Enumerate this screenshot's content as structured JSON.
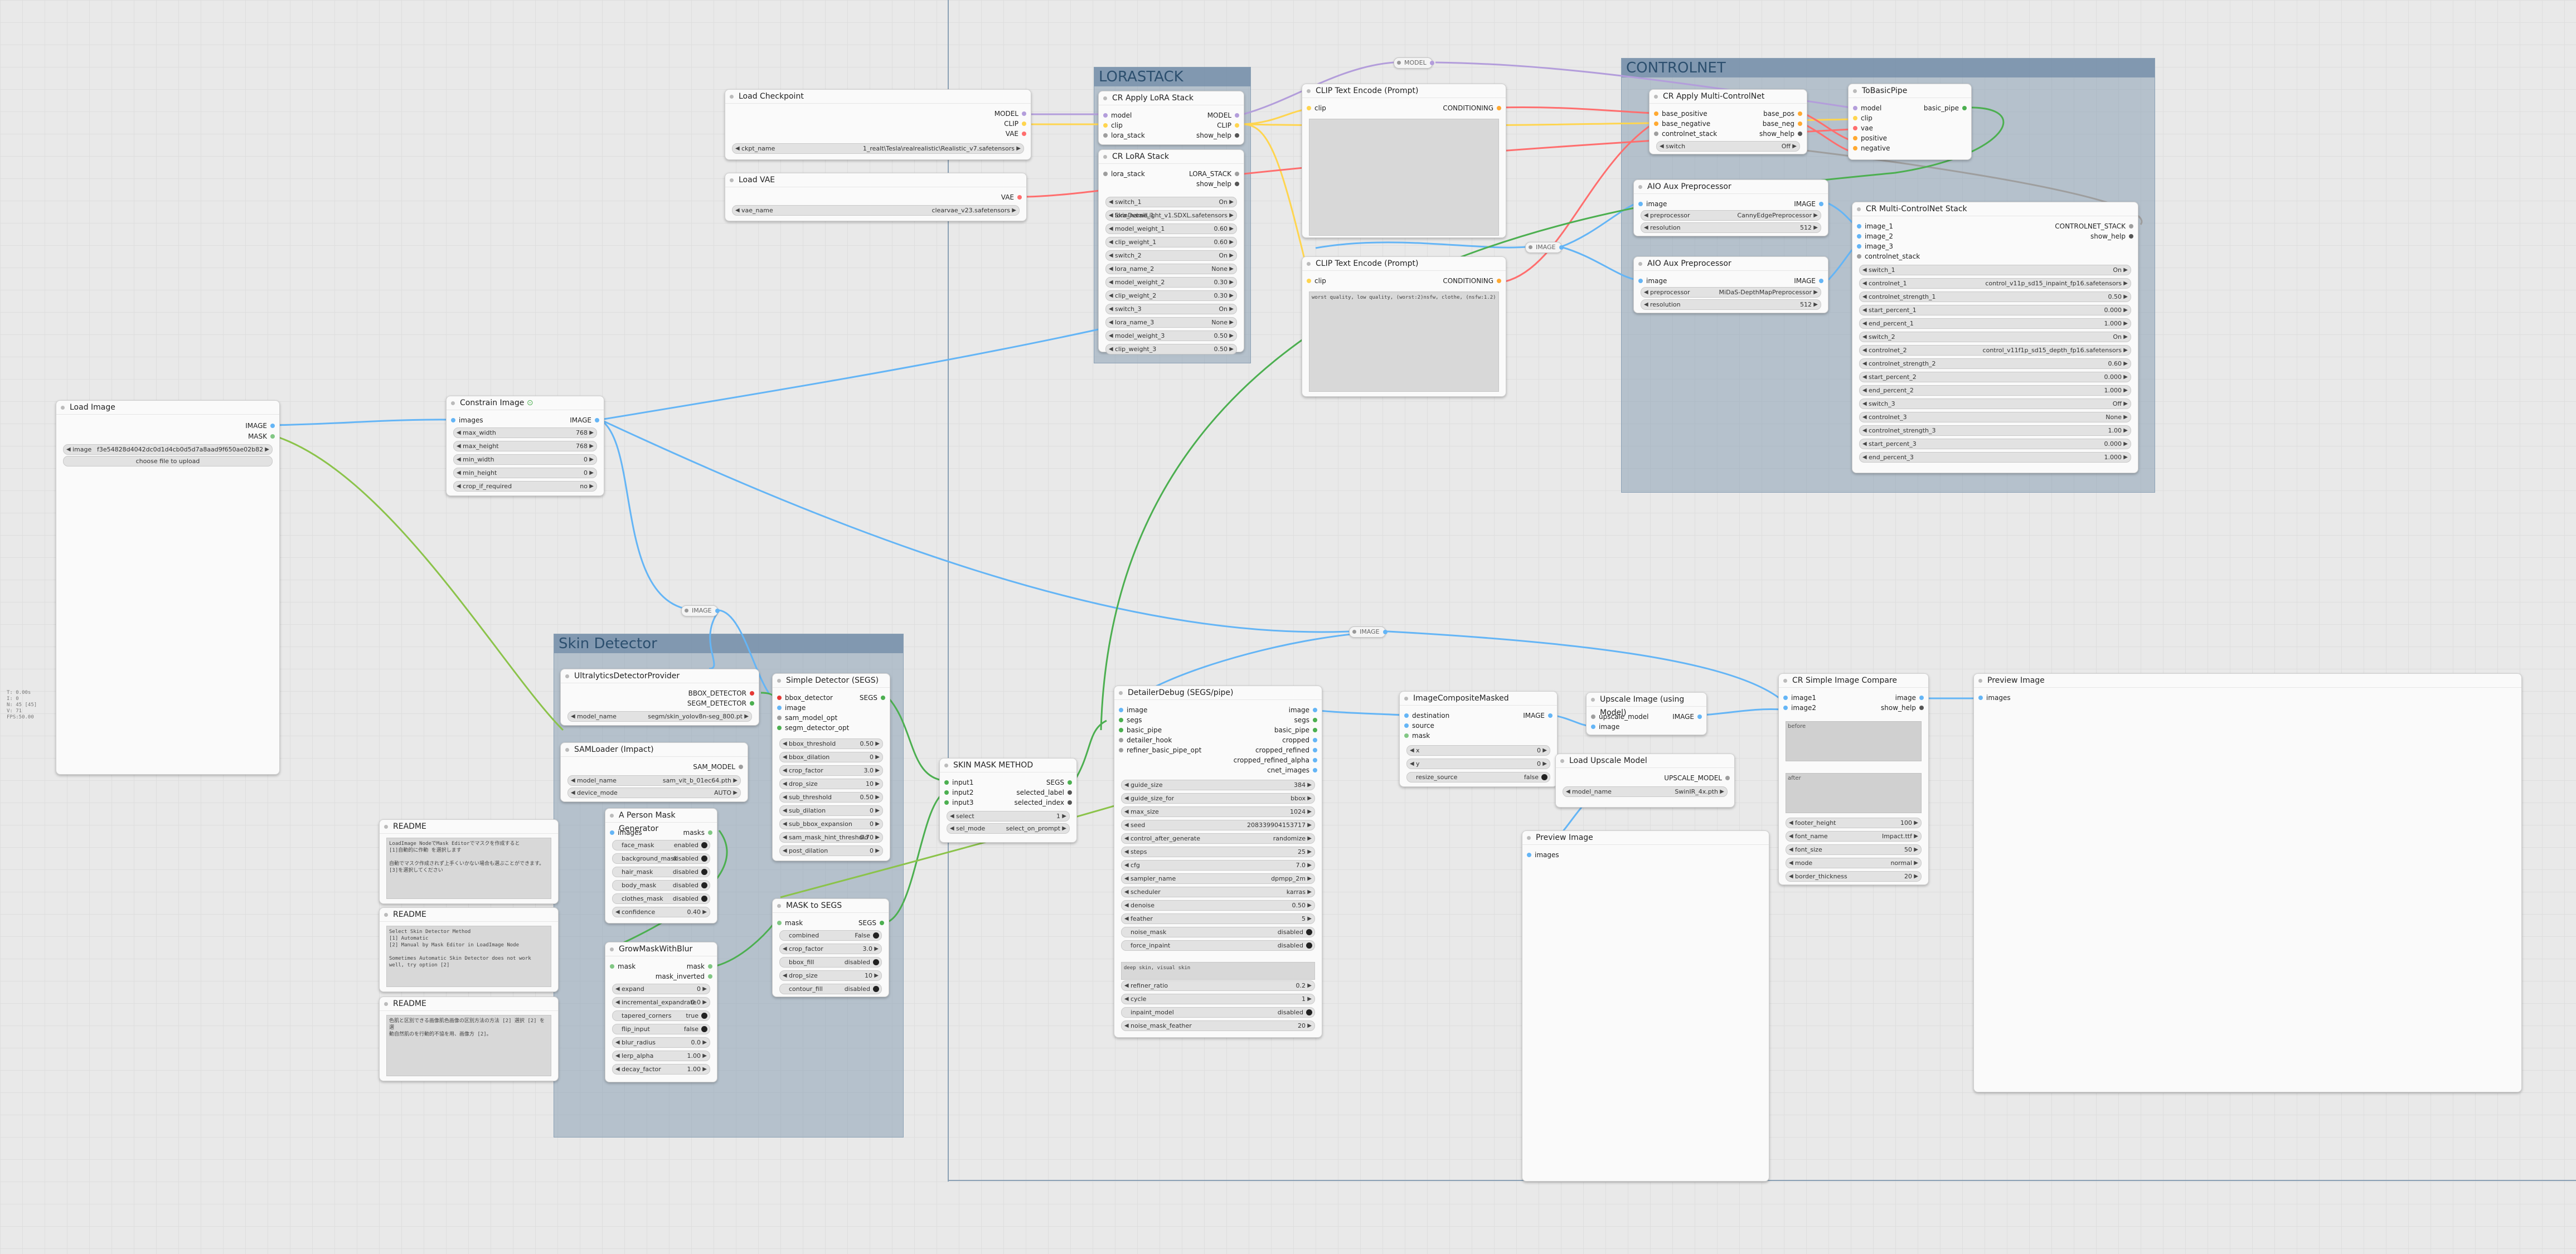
{
  "groups": {
    "lorastack": "LORASTACK",
    "controlnet": "CONTROLNET",
    "skin": "Skin Detector"
  },
  "stats": [
    "T: 0.00s",
    "I: 0",
    "N: 45 [45]",
    "V: 71",
    "FPS:50.00"
  ],
  "colors": {
    "image": "#64b5f6",
    "model": "#b39ddb",
    "clip": "#ffd54f",
    "vae": "#ff6e6e",
    "conditioning": "#ffa931",
    "mask": "#81c784",
    "lora": "#9e9e9e"
  },
  "nodes": {
    "load_checkpoint": {
      "title": "Load Checkpoint",
      "outs": [
        "MODEL",
        "CLIP",
        "VAE"
      ],
      "ckpt_label": "ckpt_name",
      "ckpt_value": "1_realt\\Tesla\\realrealistic\\Realistic_v7.safetensors"
    },
    "load_vae": {
      "title": "Load VAE",
      "out": "VAE",
      "label": "vae_name",
      "value": "clearvae_v23.safetensors"
    },
    "apply_lora": {
      "title": "CR Apply LoRA Stack",
      "ins": [
        "model",
        "clip",
        "lora_stack"
      ],
      "outs": [
        "MODEL",
        "CLIP",
        "show_help"
      ]
    },
    "lora_stack": {
      "title": "CR LoRA Stack",
      "in": "lora_stack",
      "outs": [
        "LORA_STACK",
        "show_help"
      ],
      "widgets": [
        [
          "switch_1",
          "On"
        ],
        [
          "lora_name_1",
          "SkinDetailLight_v1.SDXL.safetensors"
        ],
        [
          "model_weight_1",
          "0.60"
        ],
        [
          "clip_weight_1",
          "0.60"
        ],
        [
          "switch_2",
          "On"
        ],
        [
          "lora_name_2",
          "None"
        ],
        [
          "model_weight_2",
          "0.30"
        ],
        [
          "clip_weight_2",
          "0.30"
        ],
        [
          "switch_3",
          "On"
        ],
        [
          "lora_name_3",
          "None"
        ],
        [
          "model_weight_3",
          "0.50"
        ],
        [
          "clip_weight_3",
          "0.50"
        ]
      ]
    },
    "clip_pos": {
      "title": "CLIP Text Encode (Prompt)",
      "in": "clip",
      "out": "CONDITIONING"
    },
    "clip_neg": {
      "title": "CLIP Text Encode (Prompt)",
      "in": "clip",
      "out": "CONDITIONING",
      "text": "worst quality, low quality, (worst:2)nsfw, clothe, (nsfw:1.2)"
    },
    "apply_multi_cn": {
      "title": "CR Apply Multi-ControlNet",
      "ins": [
        "base_positive",
        "base_negative",
        "controlnet_stack"
      ],
      "outs": [
        "base_pos",
        "base_neg",
        "show_help"
      ],
      "switch_label": "switch",
      "switch_value": "Off"
    },
    "to_basic_pipe": {
      "title": "ToBasicPipe",
      "ins": [
        "model",
        "clip",
        "vae",
        "positive",
        "negative"
      ],
      "out": "basic_pipe"
    },
    "aio1": {
      "title": "AIO Aux Preprocessor",
      "in": "image",
      "out": "IMAGE",
      "pre_label": "preprocessor",
      "pre_value": "CannyEdgePreprocessor",
      "res_label": "resolution",
      "res_value": "512"
    },
    "aio2": {
      "title": "AIO Aux Preprocessor",
      "in": "image",
      "out": "IMAGE",
      "pre_label": "preprocessor",
      "pre_value": "MiDaS-DepthMapPreprocessor",
      "res_label": "resolution",
      "res_value": "512"
    },
    "multi_cn_stack": {
      "title": "CR Multi-ControlNet Stack",
      "ins": [
        "image_1",
        "image_2",
        "image_3",
        "controlnet_stack"
      ],
      "outs": [
        "CONTROLNET_STACK",
        "show_help"
      ],
      "widgets": [
        [
          "switch_1",
          "On"
        ],
        [
          "controlnet_1",
          "control_v11p_sd15_inpaint_fp16.safetensors"
        ],
        [
          "controlnet_strength_1",
          "0.50"
        ],
        [
          "start_percent_1",
          "0.000"
        ],
        [
          "end_percent_1",
          "1.000"
        ],
        [
          "switch_2",
          "On"
        ],
        [
          "controlnet_2",
          "control_v11f1p_sd15_depth_fp16.safetensors"
        ],
        [
          "controlnet_strength_2",
          "0.60"
        ],
        [
          "start_percent_2",
          "0.000"
        ],
        [
          "end_percent_2",
          "1.000"
        ],
        [
          "switch_3",
          "Off"
        ],
        [
          "controlnet_3",
          "None"
        ],
        [
          "controlnet_strength_3",
          "1.00"
        ],
        [
          "start_percent_3",
          "0.000"
        ],
        [
          "end_percent_3",
          "1.000"
        ]
      ]
    },
    "load_image": {
      "title": "Load Image",
      "outs": [
        "IMAGE",
        "MASK"
      ],
      "image_label": "image",
      "image_value": "f3e54828d4042dc0d1d4cb0d5d7a8aad9f650ae02b82af3be5e14c6936f53 (4).png",
      "upload": "choose file to upload"
    },
    "constrain": {
      "title": "Constrain Image",
      "in": "images",
      "out": "IMAGE",
      "widgets": [
        [
          "max_width",
          "768"
        ],
        [
          "max_height",
          "768"
        ],
        [
          "min_width",
          "0"
        ],
        [
          "min_height",
          "0"
        ],
        [
          "crop_if_required",
          "no"
        ]
      ]
    },
    "ultra": {
      "title": "UltralyticsDetectorProvider",
      "outs": [
        "BBOX_DETECTOR",
        "SEGM_DETECTOR"
      ],
      "label": "model_name",
      "value": "segm/skin_yolov8n-seg_800.pt"
    },
    "sam": {
      "title": "SAMLoader (Impact)",
      "out": "SAM_MODEL",
      "widgets": [
        [
          "model_name",
          "sam_vit_b_01ec64.pth"
        ],
        [
          "device_mode",
          "AUTO"
        ]
      ]
    },
    "simple_det": {
      "title": "Simple Detector (SEGS)",
      "ins": [
        "bbox_detector",
        "image",
        "sam_model_opt",
        "segm_detector_opt"
      ],
      "out": "SEGS",
      "widgets": [
        [
          "bbox_threshold",
          "0.50"
        ],
        [
          "bbox_dilation",
          "0"
        ],
        [
          "crop_factor",
          "3.0"
        ],
        [
          "drop_size",
          "10"
        ],
        [
          "sub_threshold",
          "0.50"
        ],
        [
          "sub_dilation",
          "0"
        ],
        [
          "sub_bbox_expansion",
          "0"
        ],
        [
          "sam_mask_hint_threshold",
          "0.70"
        ],
        [
          "post_dilation",
          "0"
        ]
      ]
    },
    "person_mask": {
      "title": "A Person Mask Generator",
      "in": "images",
      "out": "masks",
      "widgets": [
        [
          "face_mask",
          "enabled"
        ],
        [
          "background_mask",
          "disabled"
        ],
        [
          "hair_mask",
          "disabled"
        ],
        [
          "body_mask",
          "disabled"
        ],
        [
          "clothes_mask",
          "disabled"
        ],
        [
          "confidence",
          "0.40"
        ]
      ]
    },
    "grow_mask": {
      "title": "GrowMaskWithBlur",
      "in": "mask",
      "outs": [
        "mask",
        "mask_inverted"
      ],
      "widgets": [
        [
          "expand",
          "0"
        ],
        [
          "incremental_expandrate",
          "0.0"
        ],
        [
          "tapered_corners",
          "true"
        ],
        [
          "flip_input",
          "false"
        ],
        [
          "blur_radius",
          "0.0"
        ],
        [
          "lerp_alpha",
          "1.00"
        ],
        [
          "decay_factor",
          "1.00"
        ]
      ]
    },
    "mask_to_segs": {
      "title": "MASK to SEGS",
      "in": "mask",
      "out": "SEGS",
      "widgets": [
        [
          "combined",
          "False"
        ],
        [
          "crop_factor",
          "3.0"
        ],
        [
          "bbox_fill",
          "disabled"
        ],
        [
          "drop_size",
          "10"
        ],
        [
          "contour_fill",
          "disabled"
        ]
      ]
    },
    "skin_mask": {
      "title": "SKIN MASK METHOD",
      "ins": [
        "input1",
        "input2",
        "input3"
      ],
      "outs": [
        "SEGS",
        "selected_label",
        "selected_index"
      ],
      "widgets": [
        [
          "select",
          "1"
        ],
        [
          "sel_mode",
          "select_on_prompt"
        ]
      ]
    },
    "detailer": {
      "title": "DetailerDebug (SEGS/pipe)",
      "ins": [
        "image",
        "segs",
        "basic_pipe",
        "detailer_hook",
        "refiner_basic_pipe_opt"
      ],
      "outs": [
        "image",
        "segs",
        "basic_pipe",
        "cropped",
        "cropped_refined",
        "cropped_refined_alpha",
        "cnet_images"
      ],
      "widgets": [
        [
          "guide_size",
          "384"
        ],
        [
          "guide_size_for",
          "bbox"
        ],
        [
          "max_size",
          "1024"
        ],
        [
          "seed",
          "208339904153717"
        ],
        [
          "control_after_generate",
          "randomize"
        ],
        [
          "steps",
          "25"
        ],
        [
          "cfg",
          "7.0"
        ],
        [
          "sampler_name",
          "dpmpp_2m"
        ],
        [
          "scheduler",
          "karras"
        ],
        [
          "denoise",
          "0.50"
        ],
        [
          "feather",
          "5"
        ],
        [
          "noise_mask",
          "disabled"
        ],
        [
          "force_inpaint",
          "disabled"
        ]
      ],
      "wildcard": "deep skin, visual skin",
      "widgets2": [
        [
          "refiner_ratio",
          "0.2"
        ],
        [
          "cycle",
          "1"
        ],
        [
          "inpaint_model",
          "disabled"
        ],
        [
          "noise_mask_feather",
          "20"
        ]
      ]
    },
    "composite": {
      "title": "ImageCompositeMasked",
      "ins": [
        "destination",
        "source",
        "mask"
      ],
      "out": "IMAGE",
      "widgets": [
        [
          "x",
          "0"
        ],
        [
          "y",
          "0"
        ],
        [
          "resize_source",
          "false"
        ]
      ]
    },
    "upscale": {
      "title": "Upscale Image (using Model)",
      "ins": [
        "upscale_model",
        "image"
      ],
      "out": "IMAGE"
    },
    "load_upscale": {
      "title": "Load Upscale Model",
      "out": "UPSCALE_MODEL",
      "label": "model_name",
      "value": "SwinIR_4x.pth"
    },
    "preview_mid": {
      "title": "Preview Image",
      "in": "images"
    },
    "compare": {
      "title": "CR Simple Image Compare",
      "ins": [
        "image1",
        "image2"
      ],
      "outs": [
        "image",
        "show_help"
      ],
      "prev1": "before",
      "prev2": "after",
      "widgets": [
        [
          "footer_height",
          "100"
        ],
        [
          "font_name",
          "Impact.ttf"
        ],
        [
          "font_size",
          "50"
        ],
        [
          "mode",
          "normal"
        ],
        [
          "border_thickness",
          "20"
        ]
      ]
    },
    "preview_right": {
      "title": "Preview Image",
      "in": "images"
    },
    "readme1": {
      "title": "README",
      "text": "LoadImage NodeでMask Editorでマスクを作成すると\n[1]自動的に作動 を選択します\n\n自動でマスク作成されず上手くいかない場合も選ぶことができます。 [3]を選択してください"
    },
    "readme2": {
      "title": "README",
      "text": "Select Skin Detector Method\n[1] Automatic\n[2] Manual by Mask Editor in LoadImage Node\n\nSometimes Automatic Skin Detector does not work well, try option [2]"
    },
    "readme3": {
      "title": "README",
      "text": "色肌と区別できる画像肌色画像の区別方法の方法 [2] 選択 [2] を選\n動自然肌のを行動的不協を用、画像方 [2]。"
    }
  },
  "reroutes": {
    "image": "IMAGE",
    "model": "MODEL"
  }
}
